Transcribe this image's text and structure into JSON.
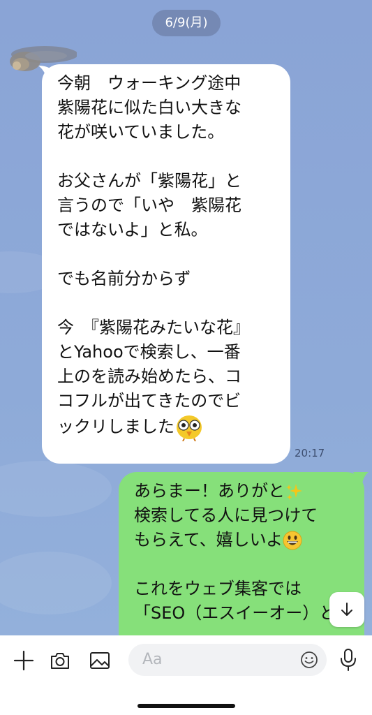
{
  "date_chip": "6/9(月)",
  "incoming": {
    "lines": [
      "今朝　ウォーキング途中",
      "紫陽花に似た白い大きな",
      "花が咲いていました。",
      "",
      "お父さんが「紫陽花」と",
      "言うので「いや　紫陽花",
      "ではないよ」と私。",
      "",
      "でも名前分からず",
      "",
      "今　『紫陽花みたいな花』",
      "とYahooで検索し、一番",
      "上のを読み始めたら、コ",
      "コフルが出てきたのでビ",
      "ックリしました"
    ],
    "time": "20:17"
  },
  "outgoing": {
    "line1": "あらまー！ありがと",
    "line2": "検索してる人に見つけて",
    "line3": "もらえて、嬉しいよ",
    "line4": "",
    "line5": "これをウェブ集客では",
    "line6": "「SEO（エスイーオー）と"
  },
  "input": {
    "placeholder": "Aa"
  },
  "colors": {
    "background": "#8fa7d6",
    "incoming_bubble": "#ffffff",
    "outgoing_bubble": "#86e07a"
  },
  "icons": [
    "plus-icon",
    "camera-icon",
    "image-icon",
    "emoji-icon",
    "microphone-icon",
    "arrow-down-icon"
  ]
}
